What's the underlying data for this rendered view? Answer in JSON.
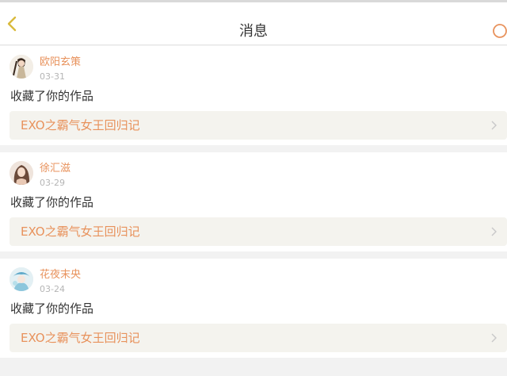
{
  "header": {
    "title": "消息",
    "back_icon": "chevron-left-icon",
    "search_icon": "search-icon",
    "accent_color": "#e8925c"
  },
  "messages": [
    {
      "user": "欧阳玄策",
      "date": "03-31",
      "action": "收藏了你的作品",
      "work_title": "EXO之霸气女王回归记"
    },
    {
      "user": "徐汇滋",
      "date": "03-29",
      "action": "收藏了你的作品",
      "work_title": "EXO之霸气女王回归记"
    },
    {
      "user": "花夜末央",
      "date": "03-24",
      "action": "收藏了你的作品",
      "work_title": "EXO之霸气女王回归记"
    }
  ]
}
